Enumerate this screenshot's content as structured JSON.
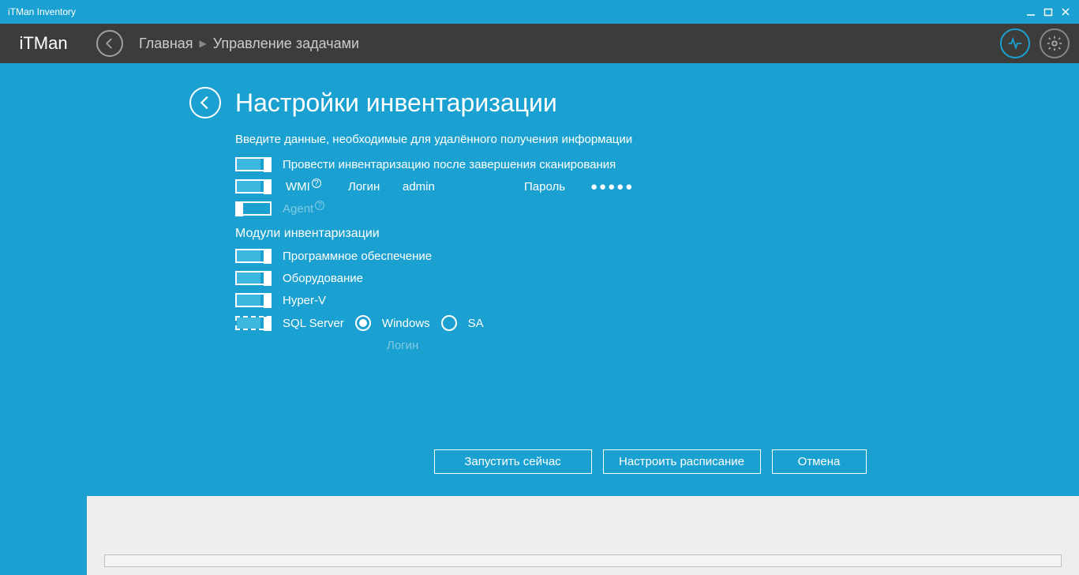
{
  "window": {
    "title": "iTMan Inventory"
  },
  "header": {
    "logo": "iTMan",
    "breadcrumb": [
      "Главная",
      "Управление задачами"
    ]
  },
  "page": {
    "title": "Управление задачами"
  },
  "modal": {
    "title": "Настройки инвентаризации",
    "subtitle": "Введите данные, необходимые для удалённого получения информации",
    "toggle_scan": {
      "label": "Провести инвентаризацию после завершения сканирования",
      "on": true
    },
    "wmi": {
      "label": "WMI",
      "on": true,
      "login_label": "Логин",
      "login_value": "admin",
      "password_label": "Пароль",
      "password_value": "●●●●●"
    },
    "agent": {
      "label": "Agent",
      "on": false
    },
    "modules_label": "Модули инвентаризации",
    "modules": {
      "software": {
        "label": "Программное обеспечение",
        "on": true
      },
      "hardware": {
        "label": "Оборудование",
        "on": true
      },
      "hyperv": {
        "label": "Hyper-V",
        "on": true
      },
      "sqlserver": {
        "label": "SQL Server",
        "on": true
      }
    },
    "sql_auth": {
      "windows": "Windows",
      "sa": "SA",
      "selected": "windows",
      "login_label": "Логин"
    },
    "buttons": {
      "run_now": "Запустить сейчас",
      "schedule": "Настроить расписание",
      "cancel": "Отмена"
    }
  }
}
